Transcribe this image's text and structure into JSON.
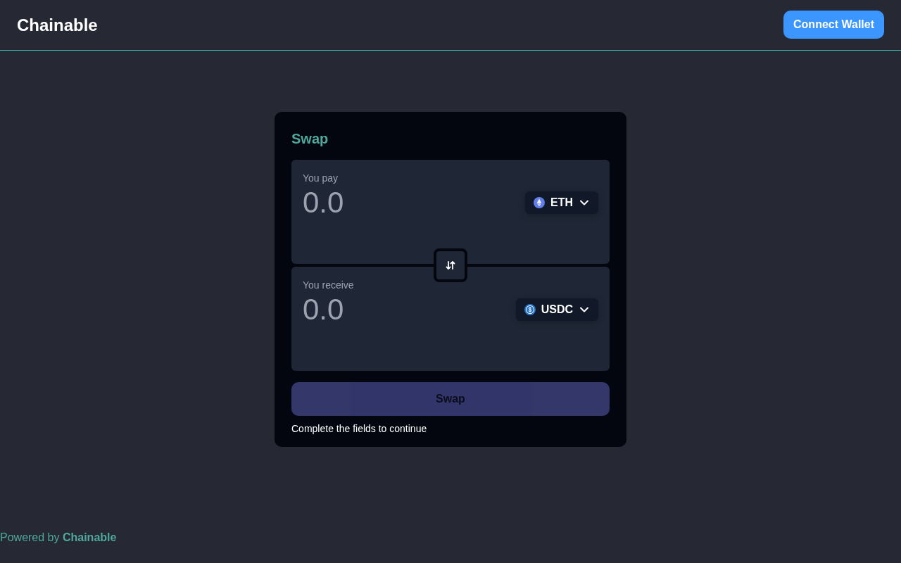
{
  "header": {
    "logo": "Chainable",
    "connect_button": "Connect Wallet"
  },
  "swap_card": {
    "title": "Swap",
    "fields": [
      {
        "label": "You pay",
        "placeholder": "0.0",
        "token": {
          "symbol": "ETH",
          "kind": "eth"
        }
      },
      {
        "label": "You receive",
        "placeholder": "0.0",
        "token": {
          "symbol": "USDC",
          "kind": "usdc"
        }
      }
    ],
    "swap_button": {
      "label": "Swap",
      "disabled": true
    },
    "hint": "Complete the fields to continue"
  },
  "footer": {
    "text": "Powered by **Chainable**"
  }
}
